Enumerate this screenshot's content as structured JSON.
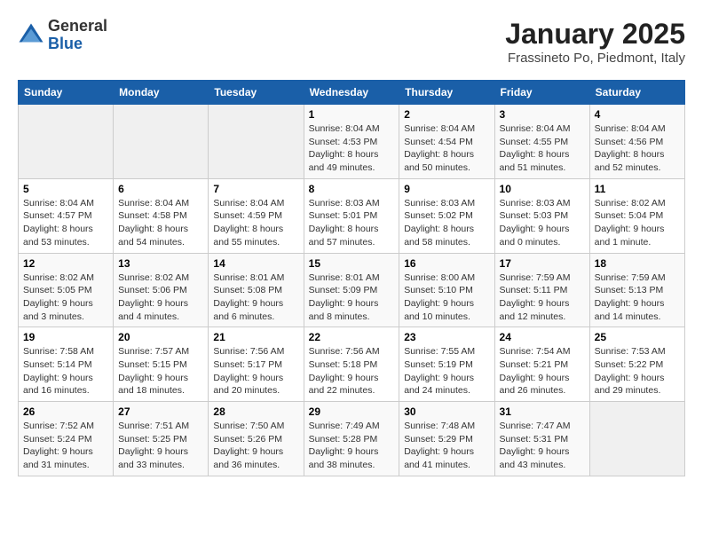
{
  "header": {
    "logo_line1": "General",
    "logo_line2": "Blue",
    "title": "January 2025",
    "subtitle": "Frassineto Po, Piedmont, Italy"
  },
  "weekdays": [
    "Sunday",
    "Monday",
    "Tuesday",
    "Wednesday",
    "Thursday",
    "Friday",
    "Saturday"
  ],
  "weeks": [
    [
      {
        "day": "",
        "info": ""
      },
      {
        "day": "",
        "info": ""
      },
      {
        "day": "",
        "info": ""
      },
      {
        "day": "1",
        "info": "Sunrise: 8:04 AM\nSunset: 4:53 PM\nDaylight: 8 hours\nand 49 minutes."
      },
      {
        "day": "2",
        "info": "Sunrise: 8:04 AM\nSunset: 4:54 PM\nDaylight: 8 hours\nand 50 minutes."
      },
      {
        "day": "3",
        "info": "Sunrise: 8:04 AM\nSunset: 4:55 PM\nDaylight: 8 hours\nand 51 minutes."
      },
      {
        "day": "4",
        "info": "Sunrise: 8:04 AM\nSunset: 4:56 PM\nDaylight: 8 hours\nand 52 minutes."
      }
    ],
    [
      {
        "day": "5",
        "info": "Sunrise: 8:04 AM\nSunset: 4:57 PM\nDaylight: 8 hours\nand 53 minutes."
      },
      {
        "day": "6",
        "info": "Sunrise: 8:04 AM\nSunset: 4:58 PM\nDaylight: 8 hours\nand 54 minutes."
      },
      {
        "day": "7",
        "info": "Sunrise: 8:04 AM\nSunset: 4:59 PM\nDaylight: 8 hours\nand 55 minutes."
      },
      {
        "day": "8",
        "info": "Sunrise: 8:03 AM\nSunset: 5:01 PM\nDaylight: 8 hours\nand 57 minutes."
      },
      {
        "day": "9",
        "info": "Sunrise: 8:03 AM\nSunset: 5:02 PM\nDaylight: 8 hours\nand 58 minutes."
      },
      {
        "day": "10",
        "info": "Sunrise: 8:03 AM\nSunset: 5:03 PM\nDaylight: 9 hours\nand 0 minutes."
      },
      {
        "day": "11",
        "info": "Sunrise: 8:02 AM\nSunset: 5:04 PM\nDaylight: 9 hours\nand 1 minute."
      }
    ],
    [
      {
        "day": "12",
        "info": "Sunrise: 8:02 AM\nSunset: 5:05 PM\nDaylight: 9 hours\nand 3 minutes."
      },
      {
        "day": "13",
        "info": "Sunrise: 8:02 AM\nSunset: 5:06 PM\nDaylight: 9 hours\nand 4 minutes."
      },
      {
        "day": "14",
        "info": "Sunrise: 8:01 AM\nSunset: 5:08 PM\nDaylight: 9 hours\nand 6 minutes."
      },
      {
        "day": "15",
        "info": "Sunrise: 8:01 AM\nSunset: 5:09 PM\nDaylight: 9 hours\nand 8 minutes."
      },
      {
        "day": "16",
        "info": "Sunrise: 8:00 AM\nSunset: 5:10 PM\nDaylight: 9 hours\nand 10 minutes."
      },
      {
        "day": "17",
        "info": "Sunrise: 7:59 AM\nSunset: 5:11 PM\nDaylight: 9 hours\nand 12 minutes."
      },
      {
        "day": "18",
        "info": "Sunrise: 7:59 AM\nSunset: 5:13 PM\nDaylight: 9 hours\nand 14 minutes."
      }
    ],
    [
      {
        "day": "19",
        "info": "Sunrise: 7:58 AM\nSunset: 5:14 PM\nDaylight: 9 hours\nand 16 minutes."
      },
      {
        "day": "20",
        "info": "Sunrise: 7:57 AM\nSunset: 5:15 PM\nDaylight: 9 hours\nand 18 minutes."
      },
      {
        "day": "21",
        "info": "Sunrise: 7:56 AM\nSunset: 5:17 PM\nDaylight: 9 hours\nand 20 minutes."
      },
      {
        "day": "22",
        "info": "Sunrise: 7:56 AM\nSunset: 5:18 PM\nDaylight: 9 hours\nand 22 minutes."
      },
      {
        "day": "23",
        "info": "Sunrise: 7:55 AM\nSunset: 5:19 PM\nDaylight: 9 hours\nand 24 minutes."
      },
      {
        "day": "24",
        "info": "Sunrise: 7:54 AM\nSunset: 5:21 PM\nDaylight: 9 hours\nand 26 minutes."
      },
      {
        "day": "25",
        "info": "Sunrise: 7:53 AM\nSunset: 5:22 PM\nDaylight: 9 hours\nand 29 minutes."
      }
    ],
    [
      {
        "day": "26",
        "info": "Sunrise: 7:52 AM\nSunset: 5:24 PM\nDaylight: 9 hours\nand 31 minutes."
      },
      {
        "day": "27",
        "info": "Sunrise: 7:51 AM\nSunset: 5:25 PM\nDaylight: 9 hours\nand 33 minutes."
      },
      {
        "day": "28",
        "info": "Sunrise: 7:50 AM\nSunset: 5:26 PM\nDaylight: 9 hours\nand 36 minutes."
      },
      {
        "day": "29",
        "info": "Sunrise: 7:49 AM\nSunset: 5:28 PM\nDaylight: 9 hours\nand 38 minutes."
      },
      {
        "day": "30",
        "info": "Sunrise: 7:48 AM\nSunset: 5:29 PM\nDaylight: 9 hours\nand 41 minutes."
      },
      {
        "day": "31",
        "info": "Sunrise: 7:47 AM\nSunset: 5:31 PM\nDaylight: 9 hours\nand 43 minutes."
      },
      {
        "day": "",
        "info": ""
      }
    ]
  ]
}
